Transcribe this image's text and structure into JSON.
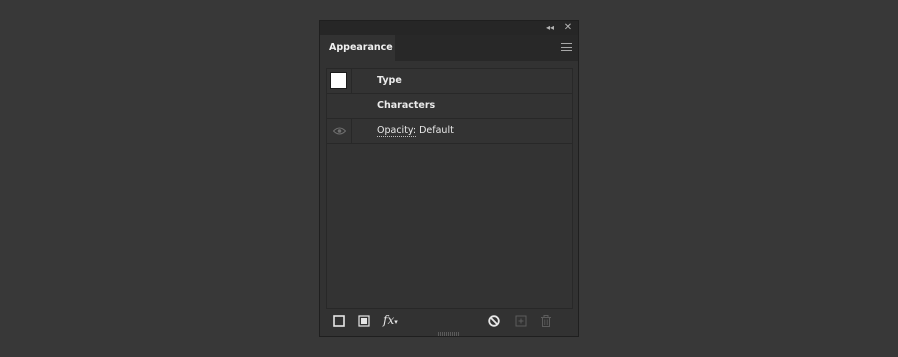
{
  "panel": {
    "tab_label": "Appearance",
    "titlebar": {
      "collapse_glyph": "◂◂",
      "close_glyph": "✕"
    },
    "rows": [
      {
        "label": "Type",
        "kind": "object",
        "swatch_color": "#ffffff"
      },
      {
        "label": "Characters",
        "kind": "container"
      },
      {
        "label_prefix": "Opacity:",
        "label_value": "Default",
        "kind": "attribute",
        "icon": "eye-icon"
      }
    ],
    "footer_icons": [
      "add-stroke-icon",
      "add-fill-icon",
      "fx-icon",
      "clear-appearance-icon",
      "duplicate-item-icon",
      "delete-item-icon"
    ],
    "fx_text": "fx"
  },
  "colors": {
    "background": "#383838",
    "panel": "#323232",
    "titlebar": "#262626",
    "border": "#282828"
  }
}
